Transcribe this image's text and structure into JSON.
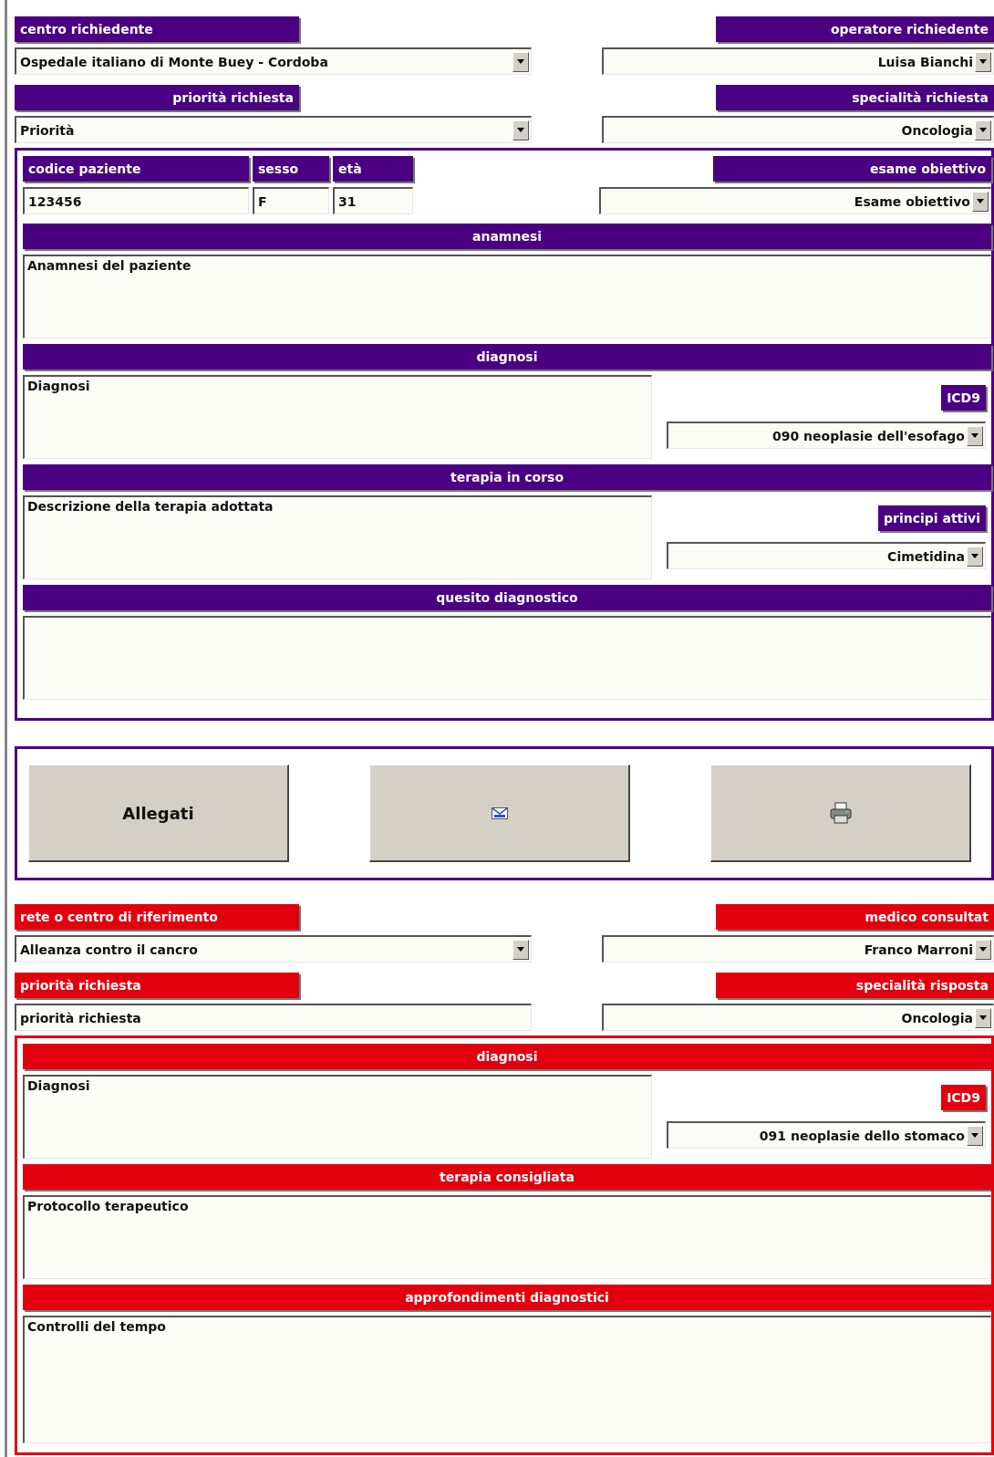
{
  "request": {
    "top_rows": [
      {
        "left": {
          "label": "centro richiedente",
          "value": "Ospedale italiano di Monte Buey - Cordoba",
          "kind": "select"
        },
        "right": {
          "label": "operatore richiedente",
          "value": "Luisa Bianchi",
          "kind": "select"
        }
      },
      {
        "left": {
          "label": "priorità richiesta",
          "value": "Priorità",
          "kind": "select"
        },
        "right": {
          "label": "specialità richiesta",
          "value": "Oncologia",
          "kind": "select"
        }
      }
    ],
    "patient_fields": [
      {
        "label": "codice paziente",
        "value": "123456"
      },
      {
        "label": "sesso",
        "value": "F"
      },
      {
        "label": "età",
        "value": "31"
      }
    ],
    "exam": {
      "label": "esame obiettivo",
      "value": "Esame obiettivo"
    },
    "blocks": [
      {
        "title": "anamnesi",
        "value": "Anamnesi del paziente"
      },
      {
        "title": "diagnosi",
        "value": "Diagnosi",
        "side": {
          "label": "ICD9",
          "value": "090 neoplasie dell'esofago"
        }
      },
      {
        "title": "terapia in corso",
        "value": "Descrizione della terapia adottata",
        "side": {
          "label": "principi attivi",
          "value": "Cimetidina"
        }
      },
      {
        "title": "quesito diagnostico"
      }
    ]
  },
  "buttons": [
    {
      "kind": "text",
      "label": "Allegati"
    },
    {
      "kind": "mail"
    },
    {
      "kind": "print"
    }
  ],
  "response": {
    "top_rows": [
      {
        "left": {
          "label": "rete o centro di riferimento",
          "value": "Alleanza contro il cancro",
          "kind": "select"
        },
        "right": {
          "label": "medico consultat",
          "value": "Franco Marroni",
          "kind": "select"
        }
      },
      {
        "left": {
          "label": "priorità richiesta",
          "value": "priorità richiesta",
          "kind": "text"
        },
        "right": {
          "label": "specialità risposta",
          "value": "Oncologia",
          "kind": "select"
        }
      }
    ],
    "blocks": [
      {
        "title": "diagnosi",
        "value": "Diagnosi",
        "side": {
          "label": "ICD9",
          "value": "091 neoplasie dello stomaco"
        }
      },
      {
        "title": "terapia consigliata",
        "value": "Protocollo terapeutico"
      },
      {
        "title": "approfondimenti diagnostici",
        "value": "Controlli del tempo"
      }
    ]
  }
}
